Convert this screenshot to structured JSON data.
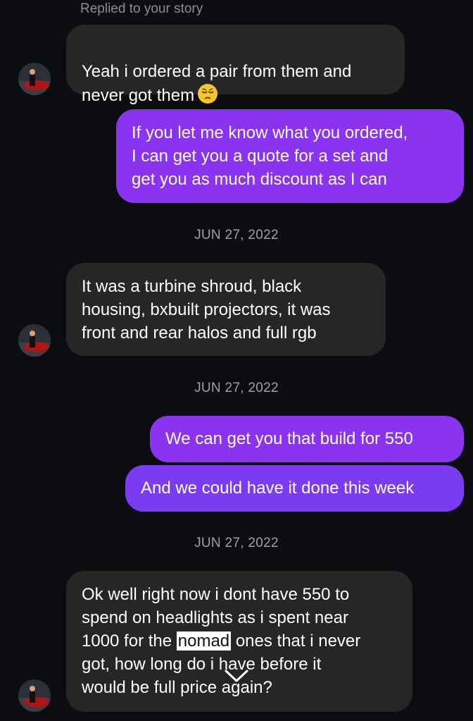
{
  "story_reply_note": "Replied to your story",
  "messages": [
    {
      "from": "them",
      "text": "Yeah i ordered a pair from them and\nnever got them",
      "emoji": "pensive-face"
    },
    {
      "from": "me",
      "text": "If you let me know what you ordered,\nI can get you a quote for a set and\nget you as much discount as I can"
    },
    {
      "from": "them",
      "text": "It was a turbine shroud, black\nhousing, bxbuilt projectors, it was\nfront and rear halos and full rgb"
    },
    {
      "from": "me",
      "text": "We can get you that build for 550"
    },
    {
      "from": "me",
      "text": "And we could have it done this week"
    },
    {
      "from": "them",
      "text_before": "Ok well right now i dont have 550 to\nspend on headlights as i spent near\n1000 for the ",
      "highlight": "nomad",
      "text_after": " ones that i never\ngot, how long do i have before it\nwould be full price again?"
    }
  ],
  "dates": [
    "JUN 27, 2022",
    "JUN 27, 2022",
    "JUN 27, 2022"
  ],
  "colors": {
    "background": "#0c0d10",
    "received_bubble": "#262626",
    "sent_bubble": "#8a34f2"
  },
  "icons": {
    "avatar": "profile-photo",
    "emoji": "pensive-face",
    "selection": "chevron-down-icon"
  }
}
